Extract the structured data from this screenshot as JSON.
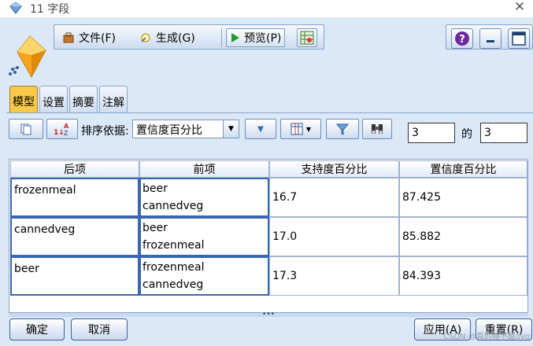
{
  "window": {
    "title": "11 字段"
  },
  "menubar": {
    "file_label": "文件(F)",
    "generate_label": "生成(G)",
    "preview_label": "预览(P)"
  },
  "tabs": [
    {
      "label": "模型",
      "active": true
    },
    {
      "label": "设置",
      "active": false
    },
    {
      "label": "摘要",
      "active": false
    },
    {
      "label": "注解",
      "active": false
    }
  ],
  "toolbar": {
    "sort_by_label": "排序依据:",
    "sort_by_value": "置信度百分比",
    "count_value": "3",
    "of_label": "的",
    "total_value": "3"
  },
  "table": {
    "columns": [
      "后项",
      "前项",
      "支持度百分比",
      "置信度百分比"
    ],
    "rows": [
      {
        "consequent": "frozenmeal",
        "antecedents": [
          "beer",
          "cannedveg"
        ],
        "support": "16.7",
        "confidence": "87.425"
      },
      {
        "consequent": "cannedveg",
        "antecedents": [
          "beer",
          "frozenmeal"
        ],
        "support": "17.0",
        "confidence": "85.882"
      },
      {
        "consequent": "beer",
        "antecedents": [
          "frozenmeal",
          "cannedveg"
        ],
        "support": "17.3",
        "confidence": "84.393"
      }
    ]
  },
  "buttons": {
    "ok": "确定",
    "cancel": "取消",
    "apply": "应用(A)",
    "reset": "重置(R)"
  },
  "watermark": "CSDN @真的睡不醒ovo",
  "colors": {
    "active_tab": "#f7c94a",
    "panel_bg": "#dbe8f7",
    "selection_border": "#3b66b0"
  }
}
